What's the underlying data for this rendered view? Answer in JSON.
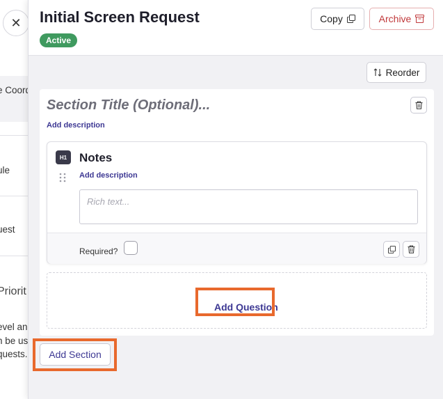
{
  "background": {
    "close_icon": "close-icon",
    "rows": [
      "e Coord",
      "ule",
      "uest",
      "Priorit"
    ],
    "paragraph": [
      "evel an",
      "n be us",
      "quests."
    ]
  },
  "drawer": {
    "title": "Initial Screen Request",
    "status_badge": "Active",
    "copy_label": "Copy",
    "archive_label": "Archive",
    "reorder_label": "Reorder",
    "section": {
      "title_placeholder": "Section Title (Optional)...",
      "add_description": "Add description",
      "question": {
        "type_icon": "H1",
        "title": "Notes",
        "add_description": "Add description",
        "rich_text_placeholder": "Rich text...",
        "required_label": "Required?"
      },
      "add_question_label": "Add Question"
    },
    "add_section_label": "Add Section"
  },
  "colors": {
    "accent": "#3d3893",
    "badge_green": "#3f9a5f",
    "archive_red": "#c0383a",
    "highlight_orange": "#e8692d"
  }
}
